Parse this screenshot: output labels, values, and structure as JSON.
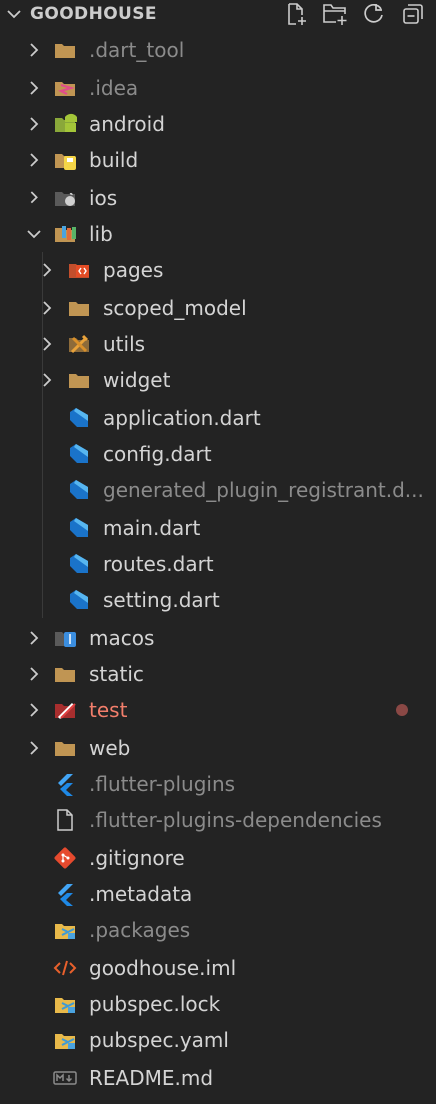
{
  "explorer": {
    "title": "GOODHOUSE",
    "actions": [
      {
        "icon": "new-file-icon"
      },
      {
        "icon": "new-folder-icon"
      },
      {
        "icon": "refresh-icon"
      },
      {
        "icon": "collapse-all-icon"
      }
    ]
  },
  "tree": {
    "dart_tool": "dart_tool",
    "dart_tool_prefix": ".",
    "idea": ".idea",
    "android": "android",
    "build": "build",
    "ios": "ios",
    "lib": "lib",
    "pages": "pages",
    "scoped_model": "scoped_model",
    "utils": "utils",
    "widget": "widget",
    "application": "application.dart",
    "config": "config.dart",
    "generated": "generated_plugin_registrant.d...",
    "main": "main.dart",
    "routes": "routes.dart",
    "setting": "setting.dart",
    "macos": "macos",
    "static": "static",
    "test": "test",
    "web": "web",
    "flutter_plugins": ".flutter-plugins",
    "flutter_plugins_deps": ".flutter-plugins-dependencies",
    "gitignore": ".gitignore",
    "metadata": ".metadata",
    "packages": ".packages",
    "iml": "goodhouse.iml",
    "pubspec_lock": "pubspec.lock",
    "pubspec_yaml": "pubspec.yaml",
    "readme": "README.md"
  },
  "colors": {
    "background": "#232323",
    "text": "#d4d4d4",
    "dim_text": "#8b8b8b",
    "error_text": "#f27e6b",
    "modified_dot": "#8a4845",
    "folder": "#c09553",
    "dart": "#1a73c9"
  }
}
